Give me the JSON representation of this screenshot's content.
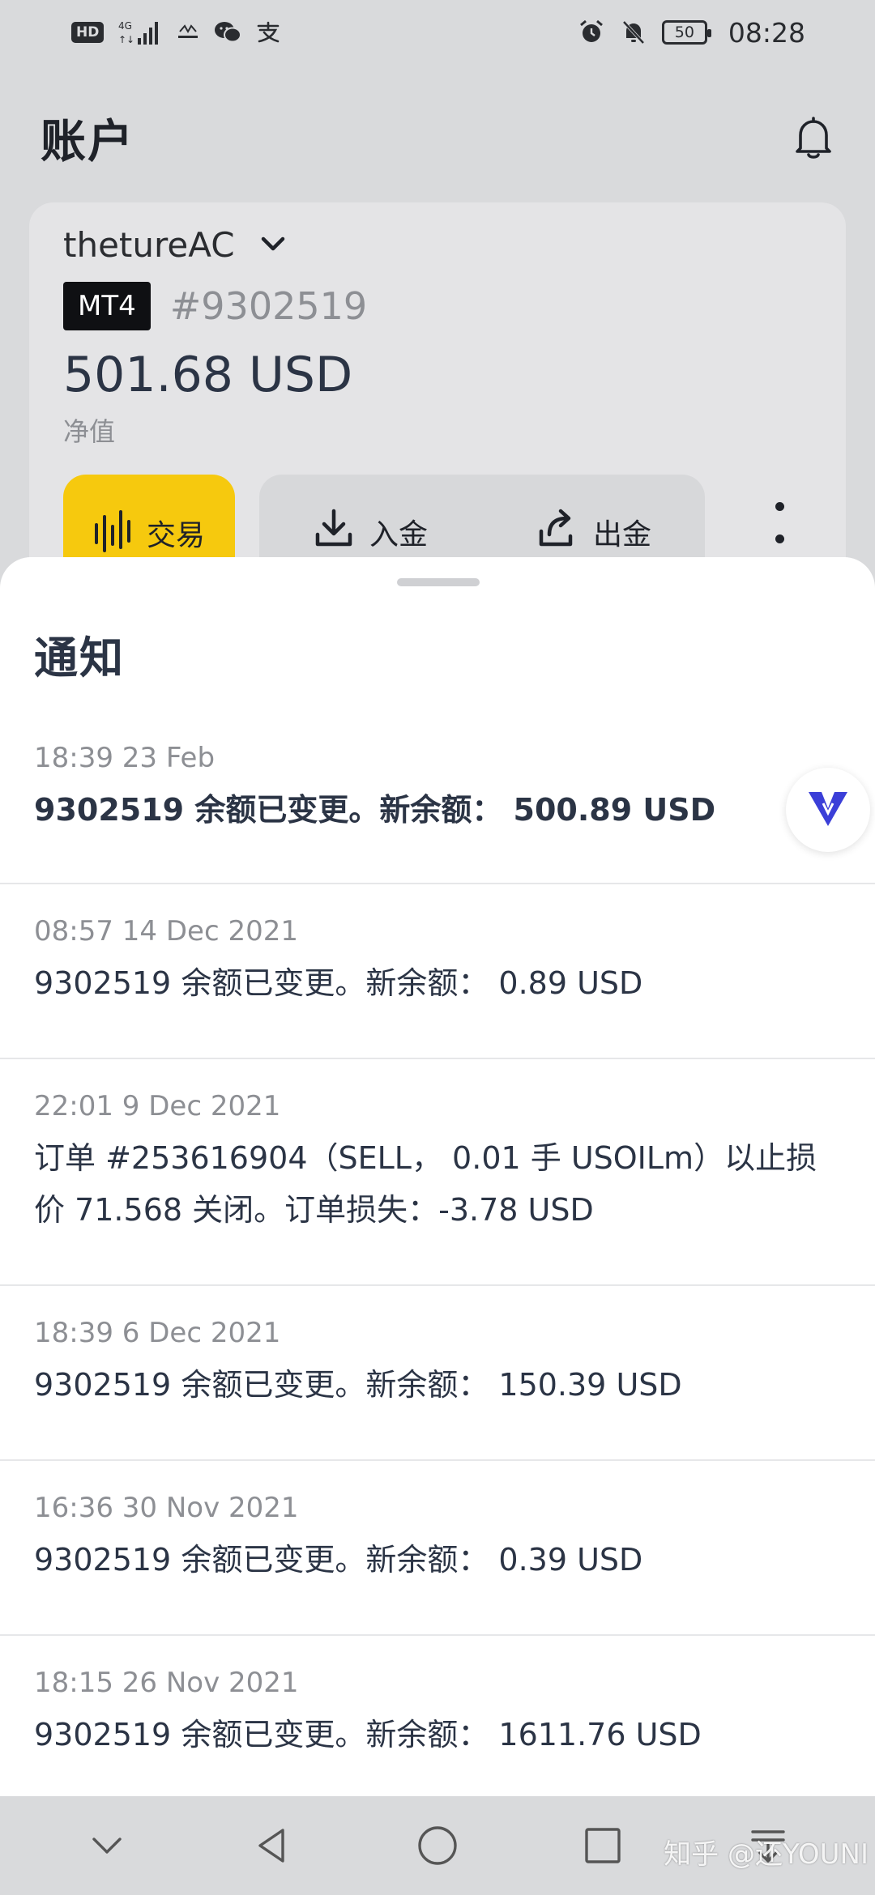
{
  "status_bar": {
    "left_icons": [
      "hd-icon",
      "signal-4g-icon",
      "exness-icon",
      "wechat-icon",
      "alipay-icon"
    ],
    "hd_label": "HD",
    "battery_level": "50",
    "time": "08:28"
  },
  "header": {
    "title": "账户"
  },
  "account": {
    "name": "thetureAC",
    "platform_badge": "MT4",
    "number": "#9302519",
    "balance": "501.68 USD",
    "balance_label": "净值",
    "trade_label": "交易",
    "deposit_label": "入金",
    "withdraw_label": "出金"
  },
  "sheet": {
    "title": "通知",
    "notifications": [
      {
        "time": "18:39 23 Feb",
        "message": "9302519 余额已变更。新余额： 500.89 USD",
        "unread": true
      },
      {
        "time": "08:57 14 Dec 2021",
        "message": "9302519 余额已变更。新余额： 0.89 USD",
        "unread": false
      },
      {
        "time": "22:01 9 Dec 2021",
        "message": "订单 #253616904（SELL， 0.01 手 USOILm）以止损价 71.568 关闭。订单损失：-3.78 USD",
        "unread": false
      },
      {
        "time": "18:39 6 Dec 2021",
        "message": "9302519 余额已变更。新余额： 150.39 USD",
        "unread": false
      },
      {
        "time": "16:36 30 Nov 2021",
        "message": "9302519 余额已变更。新余额： 0.39 USD",
        "unread": false
      },
      {
        "time": "18:15 26 Nov 2021",
        "message": "9302519 余额已变更。新余额： 1611.76 USD",
        "unread": false
      }
    ]
  },
  "watermark": "知乎 @还YOUNI",
  "colors": {
    "accent_yellow": "#f6c90e",
    "text_dark": "#2b3445",
    "text_muted": "#8d8f94",
    "vpn_blue": "#3b3fd8"
  }
}
